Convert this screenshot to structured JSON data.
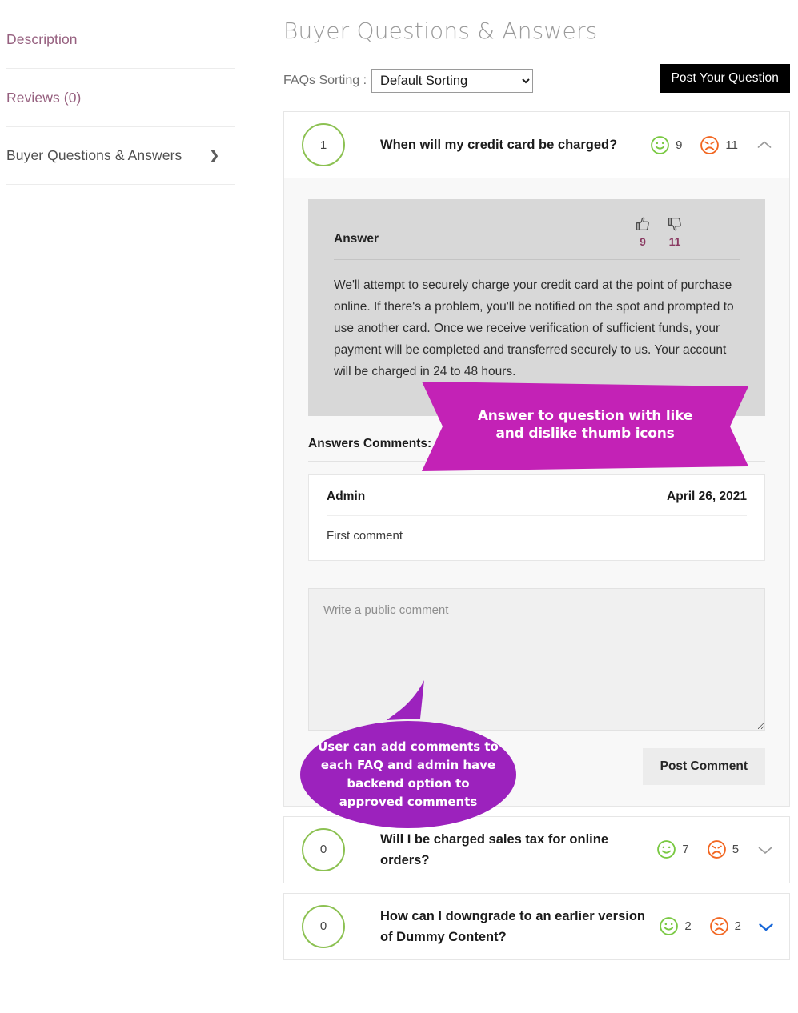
{
  "sidebar": {
    "items": [
      {
        "label": "Description",
        "state": "muted",
        "chevron": false
      },
      {
        "label": "Reviews (0)",
        "state": "muted",
        "chevron": false
      },
      {
        "label": "Buyer Questions & Answers",
        "state": "active",
        "chevron": true,
        "chevron_glyph": "❯"
      }
    ]
  },
  "main": {
    "title": "Buyer Questions & Answers",
    "toolbar": {
      "sort_label": "FAQs Sorting :",
      "sort_selected": "Default Sorting",
      "sort_options": [
        "Default Sorting"
      ],
      "post_question_label": "Post Your Question"
    },
    "faqs": [
      {
        "count": "1",
        "question": "When will my credit card be charged?",
        "likes": "9",
        "dislikes": "11",
        "expanded": true,
        "toggle_glyph": "∧",
        "toggle_color": "#9a9a9a",
        "answer": {
          "label": "Answer",
          "likes": "9",
          "dislikes": "11",
          "text": "We'll attempt to securely charge your credit card at the point of purchase online. If there's a problem, you'll be notified on the spot and prompted to use another card. Once we receive verification of sufficient funds, your payment will be completed and transferred securely to us. Your account will be charged in 24 to 48 hours."
        },
        "comments_title": "Answers Comments:",
        "comments": [
          {
            "author": "Admin",
            "date": "April 26, 2021",
            "body": "First comment"
          }
        ],
        "comment_form": {
          "placeholder": "Write a public comment",
          "value": "",
          "submit_label": "Post Comment"
        }
      },
      {
        "count": "0",
        "question": "Will I be charged sales tax for online orders?",
        "likes": "7",
        "dislikes": "5",
        "expanded": false,
        "toggle_glyph": "∨",
        "toggle_color": "#9a9a9a"
      },
      {
        "count": "0",
        "question": "How can I downgrade to an earlier version of Dummy Content?",
        "likes": "2",
        "dislikes": "2",
        "expanded": false,
        "toggle_glyph": "∨",
        "toggle_color": "#1565d8"
      }
    ]
  },
  "callouts": {
    "ribbon": {
      "text_line1": "Answer to question with like",
      "text_line2": "and dislike thumb icons",
      "color": "#c322b6"
    },
    "bubble": {
      "text_line1": "User can add comments to",
      "text_line2": "each FAQ and admin have",
      "text_line3": "backend option to",
      "text_line4": "approved comments",
      "color": "#9c22bd"
    }
  },
  "colors": {
    "like_green": "#7ac943",
    "dislike_orange": "#f26722",
    "sidebar_link": "#96607f",
    "thumb_count": "#8a3a62",
    "answer_bg": "#d8d8d8"
  }
}
